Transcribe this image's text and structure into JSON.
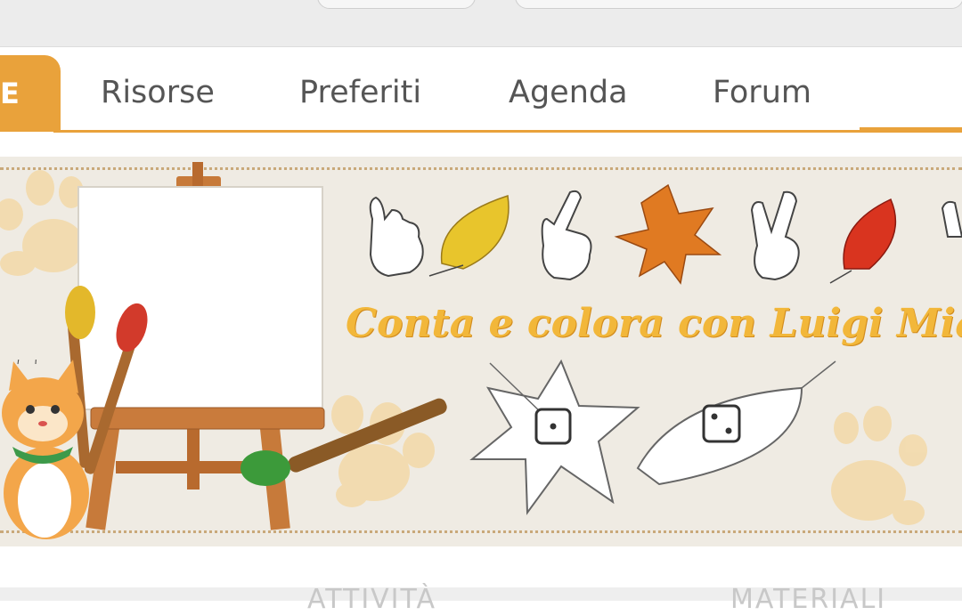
{
  "nav": {
    "active_tab": "E",
    "tabs": [
      {
        "label": "Risorse"
      },
      {
        "label": "Preferiti"
      },
      {
        "label": "Agenda"
      },
      {
        "label": "Forum"
      }
    ]
  },
  "banner": {
    "title": "Conta e colora con Luigi Miaugu"
  },
  "bottom": {
    "left_text": "ATTIVITÀ",
    "right_text": "MATERIALI"
  },
  "colors": {
    "accent": "#e9a23b",
    "title": "#f2b73a"
  }
}
